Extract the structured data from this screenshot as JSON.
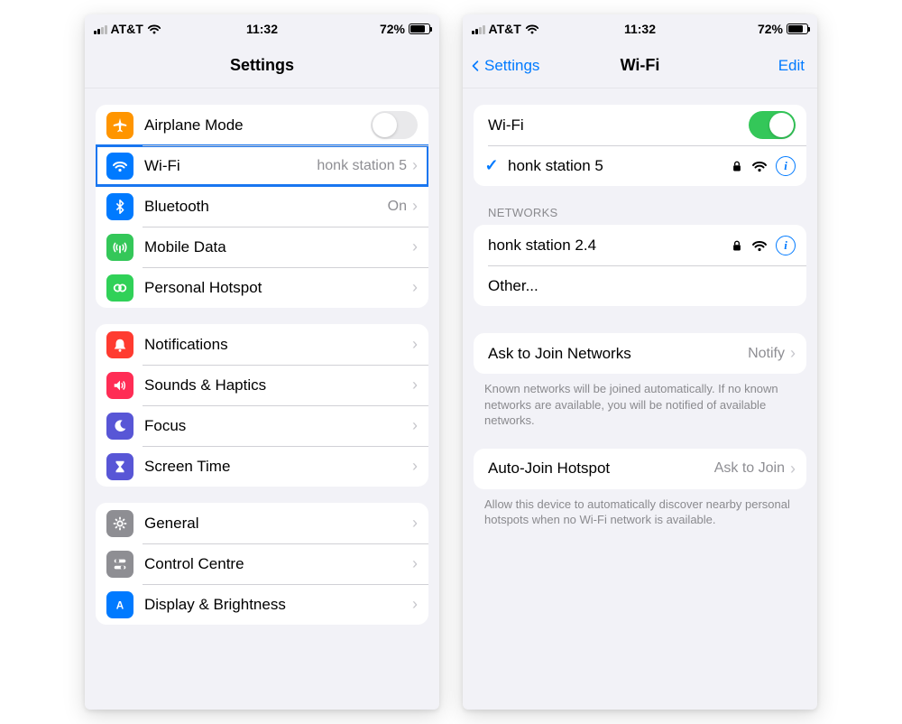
{
  "statusbar": {
    "carrier": "AT&T",
    "time": "11:32",
    "battery_percent": "72%"
  },
  "left_screen": {
    "title": "Settings",
    "group1": {
      "airplane": "Airplane Mode",
      "wifi": "Wi-Fi",
      "wifi_detail": "honk station 5",
      "bluetooth": "Bluetooth",
      "bluetooth_detail": "On",
      "mobile_data": "Mobile Data",
      "personal_hotspot": "Personal Hotspot"
    },
    "group2": {
      "notifications": "Notifications",
      "sounds": "Sounds & Haptics",
      "focus": "Focus",
      "screen_time": "Screen Time"
    },
    "group3": {
      "general": "General",
      "control_centre": "Control Centre",
      "display": "Display & Brightness"
    }
  },
  "right_screen": {
    "back_label": "Settings",
    "title": "Wi-Fi",
    "edit": "Edit",
    "wifi_toggle_label": "Wi-Fi",
    "connected_network": "honk station 5",
    "networks_header": "Networks",
    "networks": {
      "n0": "honk station 2.4",
      "other": "Other..."
    },
    "ask_join_label": "Ask to Join Networks",
    "ask_join_value": "Notify",
    "ask_join_footer": "Known networks will be joined automatically. If no known networks are available, you will be notified of available networks.",
    "auto_join_label": "Auto-Join Hotspot",
    "auto_join_value": "Ask to Join",
    "auto_join_footer": "Allow this device to automatically discover nearby personal hotspots when no Wi-Fi network is available."
  }
}
